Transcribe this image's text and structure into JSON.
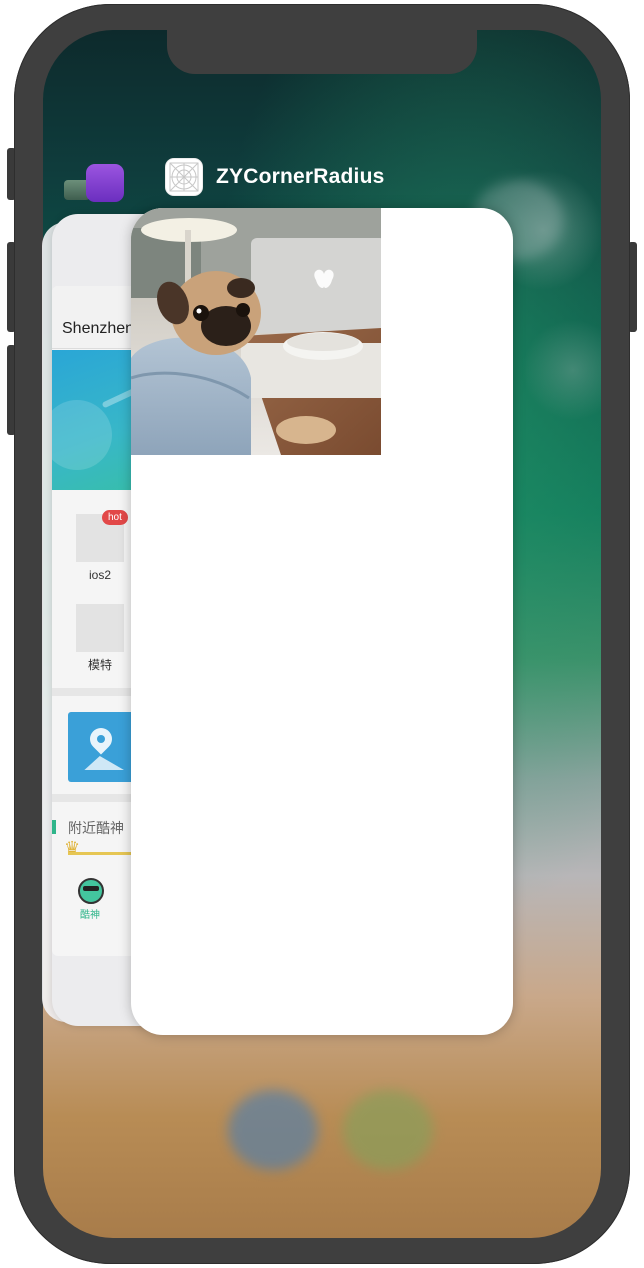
{
  "switcher": {
    "app_name": "ZYCornerRadius",
    "app_icon": "blueprint-app-icon"
  },
  "background_app": {
    "header_title": "Shenzhen",
    "hot_badge": "hot",
    "grid_items": [
      {
        "label": "ios2"
      },
      {
        "label": "模特"
      }
    ],
    "section_title": "附近酷神",
    "tab_label": "酷神"
  },
  "front_card": {
    "photo_subject": "pug-in-sweater-photo"
  },
  "colors": {
    "accent_green": "#2fb58a",
    "hot_red": "#e24848",
    "frame_gray": "#3f3f3f"
  }
}
